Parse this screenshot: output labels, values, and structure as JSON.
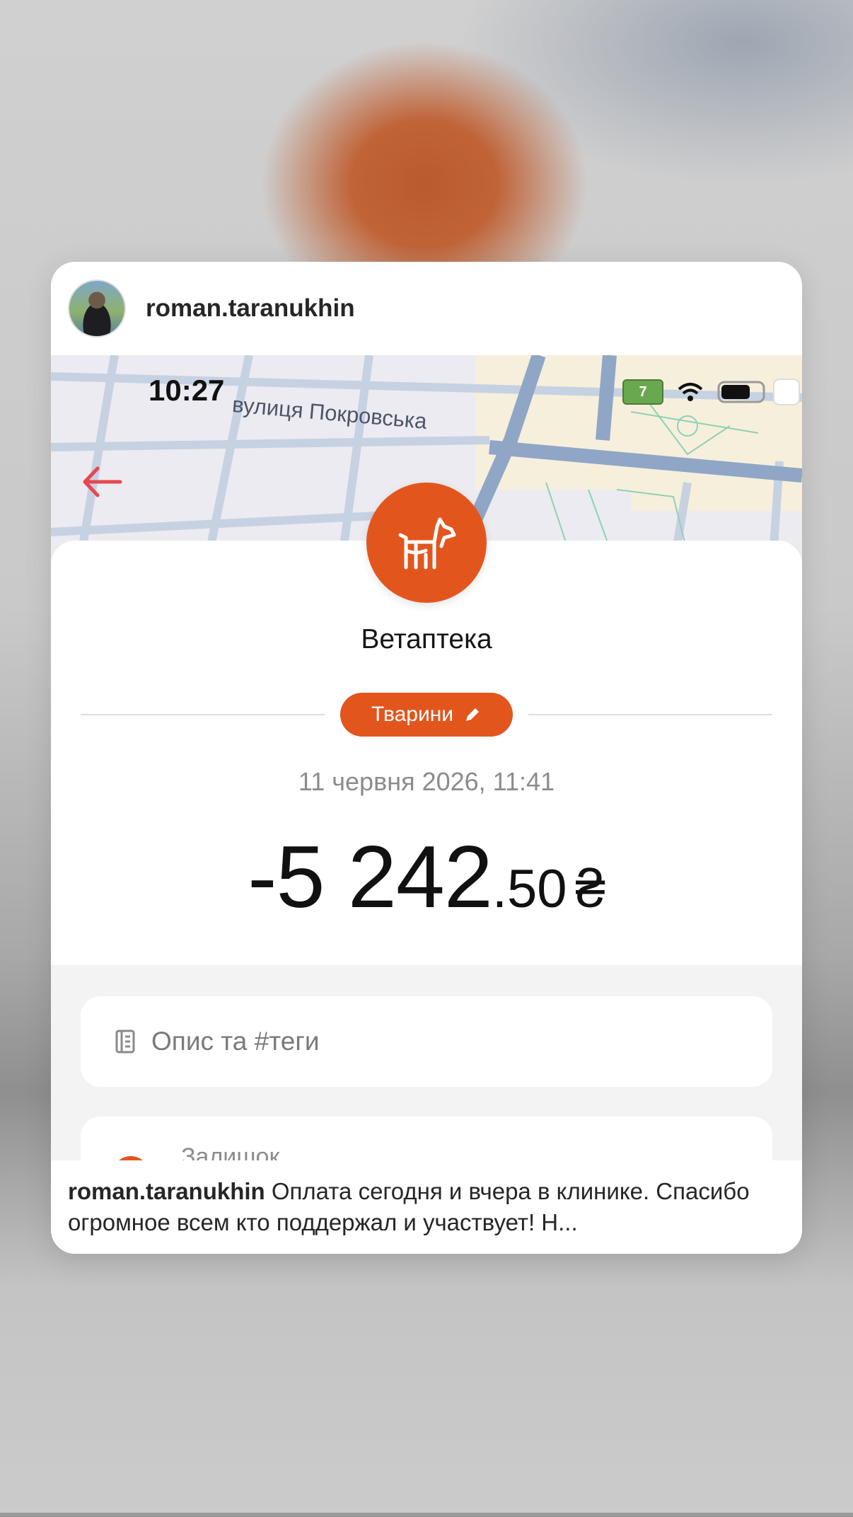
{
  "post": {
    "username": "roman.taranukhin",
    "caption_user": "roman.taranukhin",
    "caption_text": "Оплата сегодня и вчера в клинике. Спасибо огромное всем кто поддержал и участвует! Н..."
  },
  "screenshot": {
    "status_time": "10:27",
    "street_label": "вулиця Покровська",
    "battery_text": "7",
    "merchant": "Ветаптека",
    "category_label": "Тварини",
    "date_time": "11 червня 2026, 11:41",
    "amount": {
      "whole": "-5 242",
      "fraction": ".50",
      "currency": "₴"
    },
    "description_placeholder": "Опис та #теги",
    "balance_label": "Залишок"
  },
  "icons": {
    "back": "arrow-left-icon",
    "category": "dog-icon",
    "edit": "pencil-icon",
    "notes": "notes-icon",
    "wifi": "wifi-icon",
    "battery": "battery-icon"
  },
  "colors": {
    "accent": "#e2561e",
    "back_arrow": "#e5484d",
    "battery_green": "#6aa84f"
  }
}
